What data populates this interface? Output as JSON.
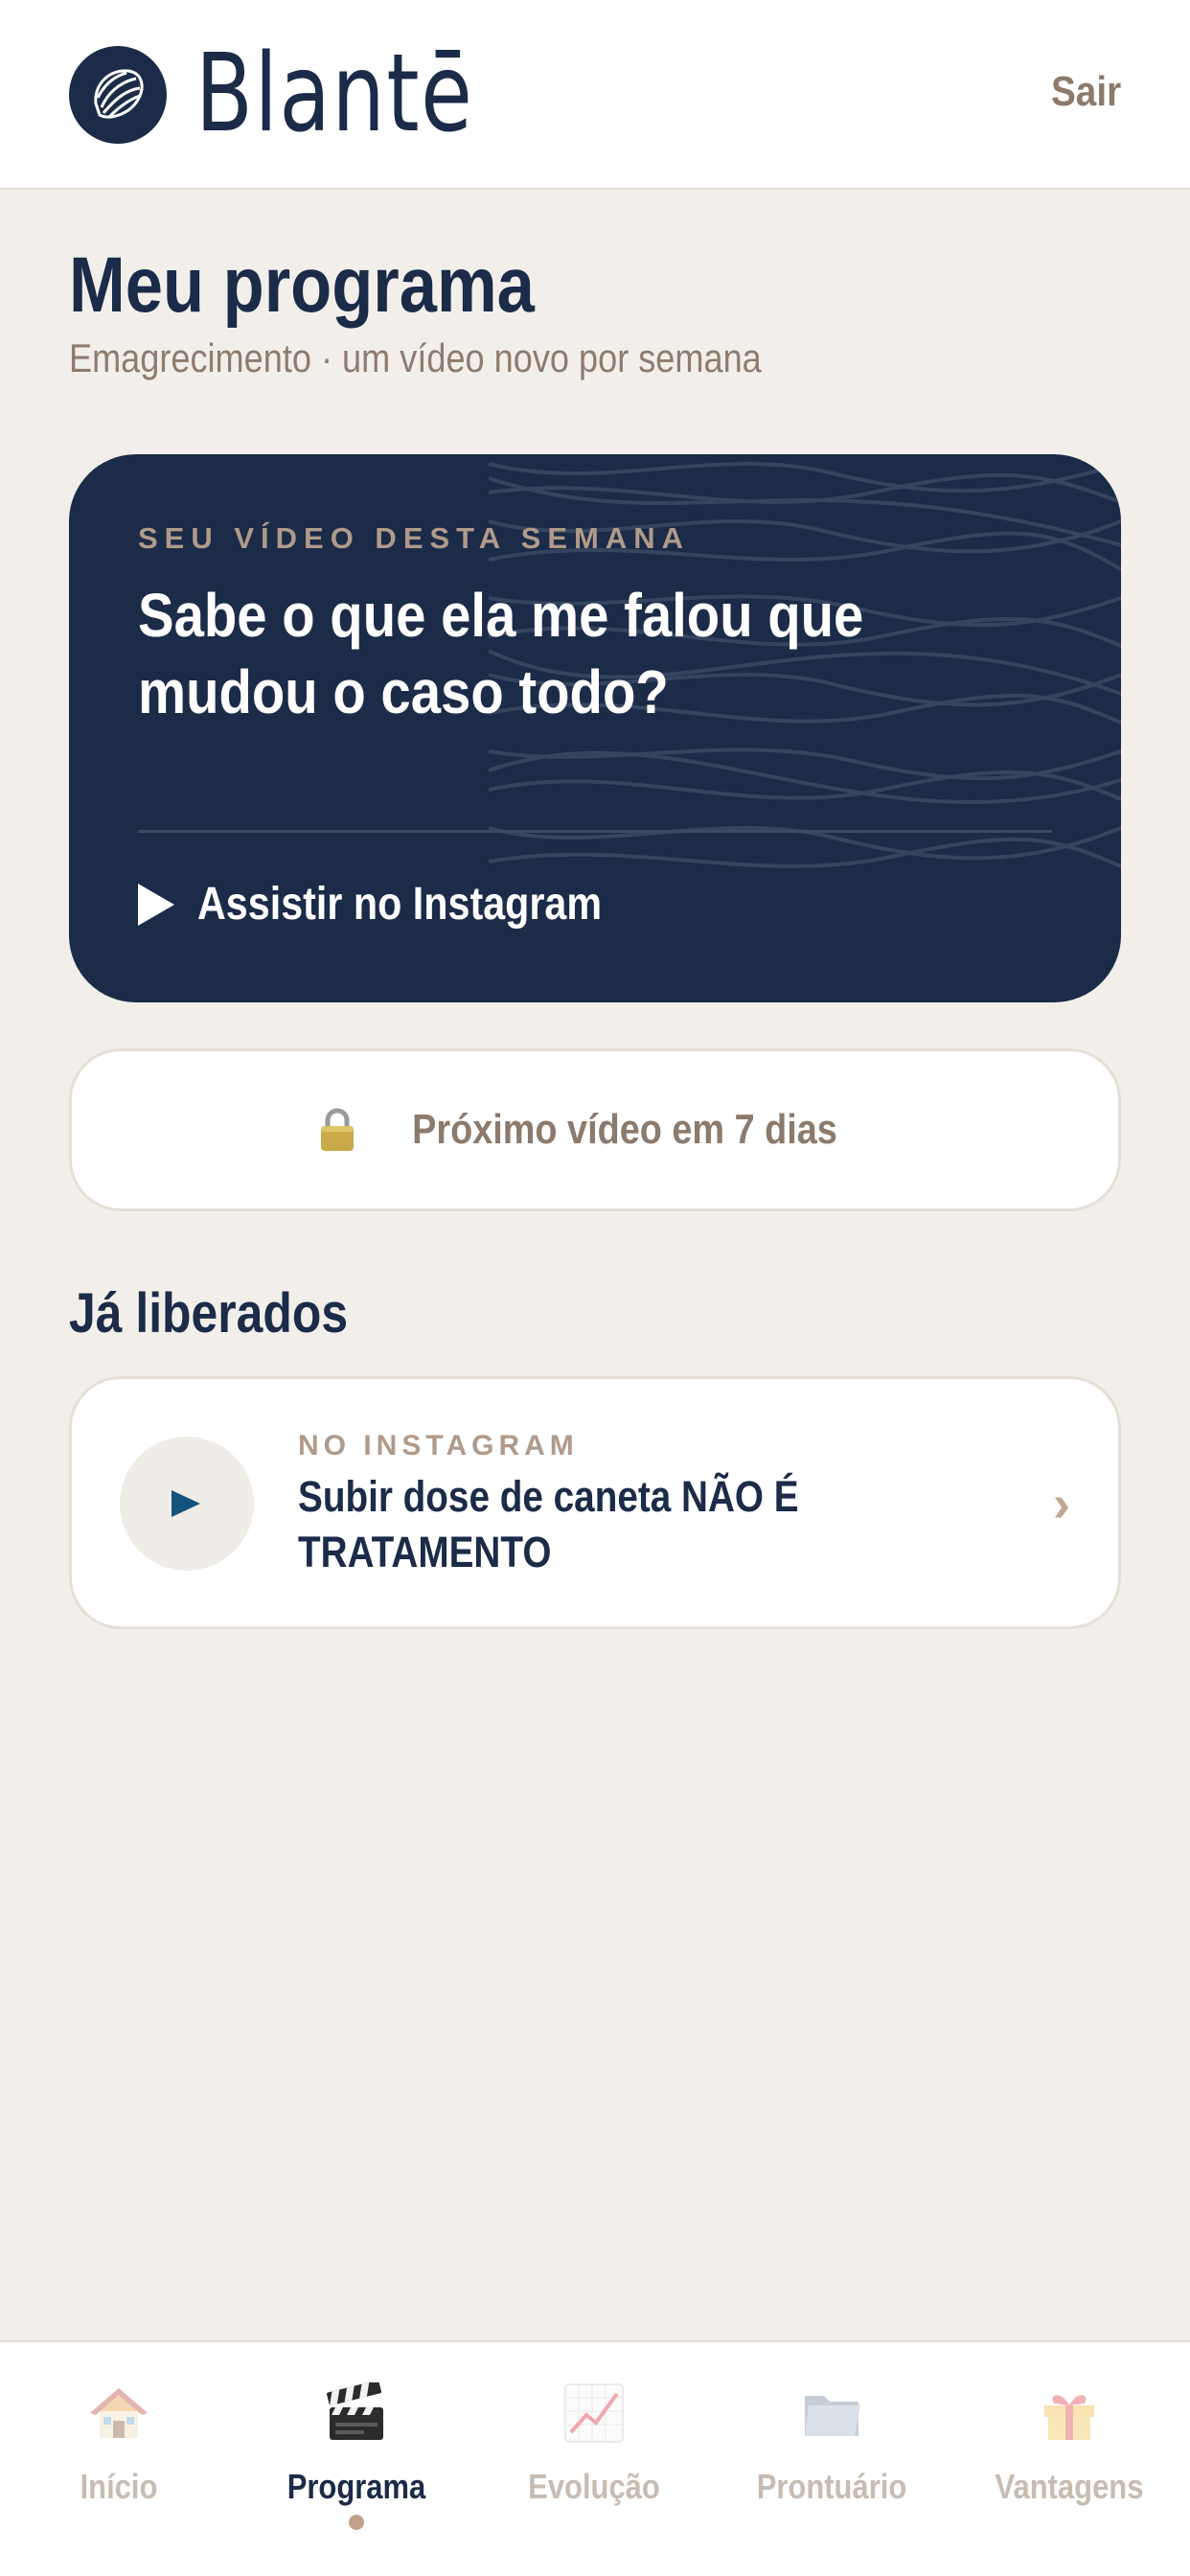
{
  "header": {
    "brand": "Blantē",
    "logout_label": "Sair"
  },
  "page": {
    "title": "Meu programa",
    "subtitle": "Emagrecimento · um vídeo novo por semana"
  },
  "weekly_video": {
    "eyebrow": "SEU VÍDEO DESTA SEMANA",
    "title": "Sabe o que ela me falou que mudou o caso todo?",
    "watch_label": "Assistir no Instagram"
  },
  "next_video": {
    "label": "Próximo vídeo em 7 dias"
  },
  "released": {
    "section_title": "Já liberados",
    "items": [
      {
        "eyebrow": "NO INSTAGRAM",
        "title": "Subir dose de caneta NÃO É TRATAMENTO",
        "chevron": "›"
      }
    ]
  },
  "bottom_nav": {
    "active": "Programa",
    "items": [
      {
        "label": "Início",
        "icon": "house-icon"
      },
      {
        "label": "Programa",
        "icon": "clapperboard-icon"
      },
      {
        "label": "Evolução",
        "icon": "chart-increasing-icon"
      },
      {
        "label": "Prontuário",
        "icon": "folder-icon"
      },
      {
        "label": "Vantagens",
        "icon": "gift-icon"
      }
    ]
  },
  "colors": {
    "navy": "#1b2b48",
    "background": "#f2efeb",
    "accent_tan": "#b09a8a",
    "muted_text": "#8c7a6c"
  }
}
